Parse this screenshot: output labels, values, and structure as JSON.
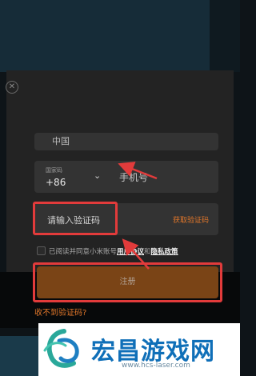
{
  "form": {
    "partial_field_text": "中国",
    "country_code_label": "国家码",
    "country_code_value": "+86",
    "phone_placeholder": "手机号",
    "code_placeholder": "请输入验证码",
    "get_code_label": "获取验证码",
    "agreement_prefix": "已阅读并同意小米账号",
    "agreement_user_link": "用户协议",
    "agreement_and": "和",
    "agreement_privacy_link": "隐私政策",
    "register_label": "注册",
    "no_code_label": "收不到验证码?"
  },
  "icons": {
    "close": "close-icon",
    "chevron": "chevron-down-icon",
    "logo": "logo-emblem-icon"
  },
  "watermark": {
    "name": "宏昌游戏网",
    "url": "www.hcs-laser.com"
  },
  "colors": {
    "accent": "#e0762a",
    "register_bg": "#7a4416",
    "highlight": "#e23b3b",
    "brand": "#0f6fb8"
  }
}
